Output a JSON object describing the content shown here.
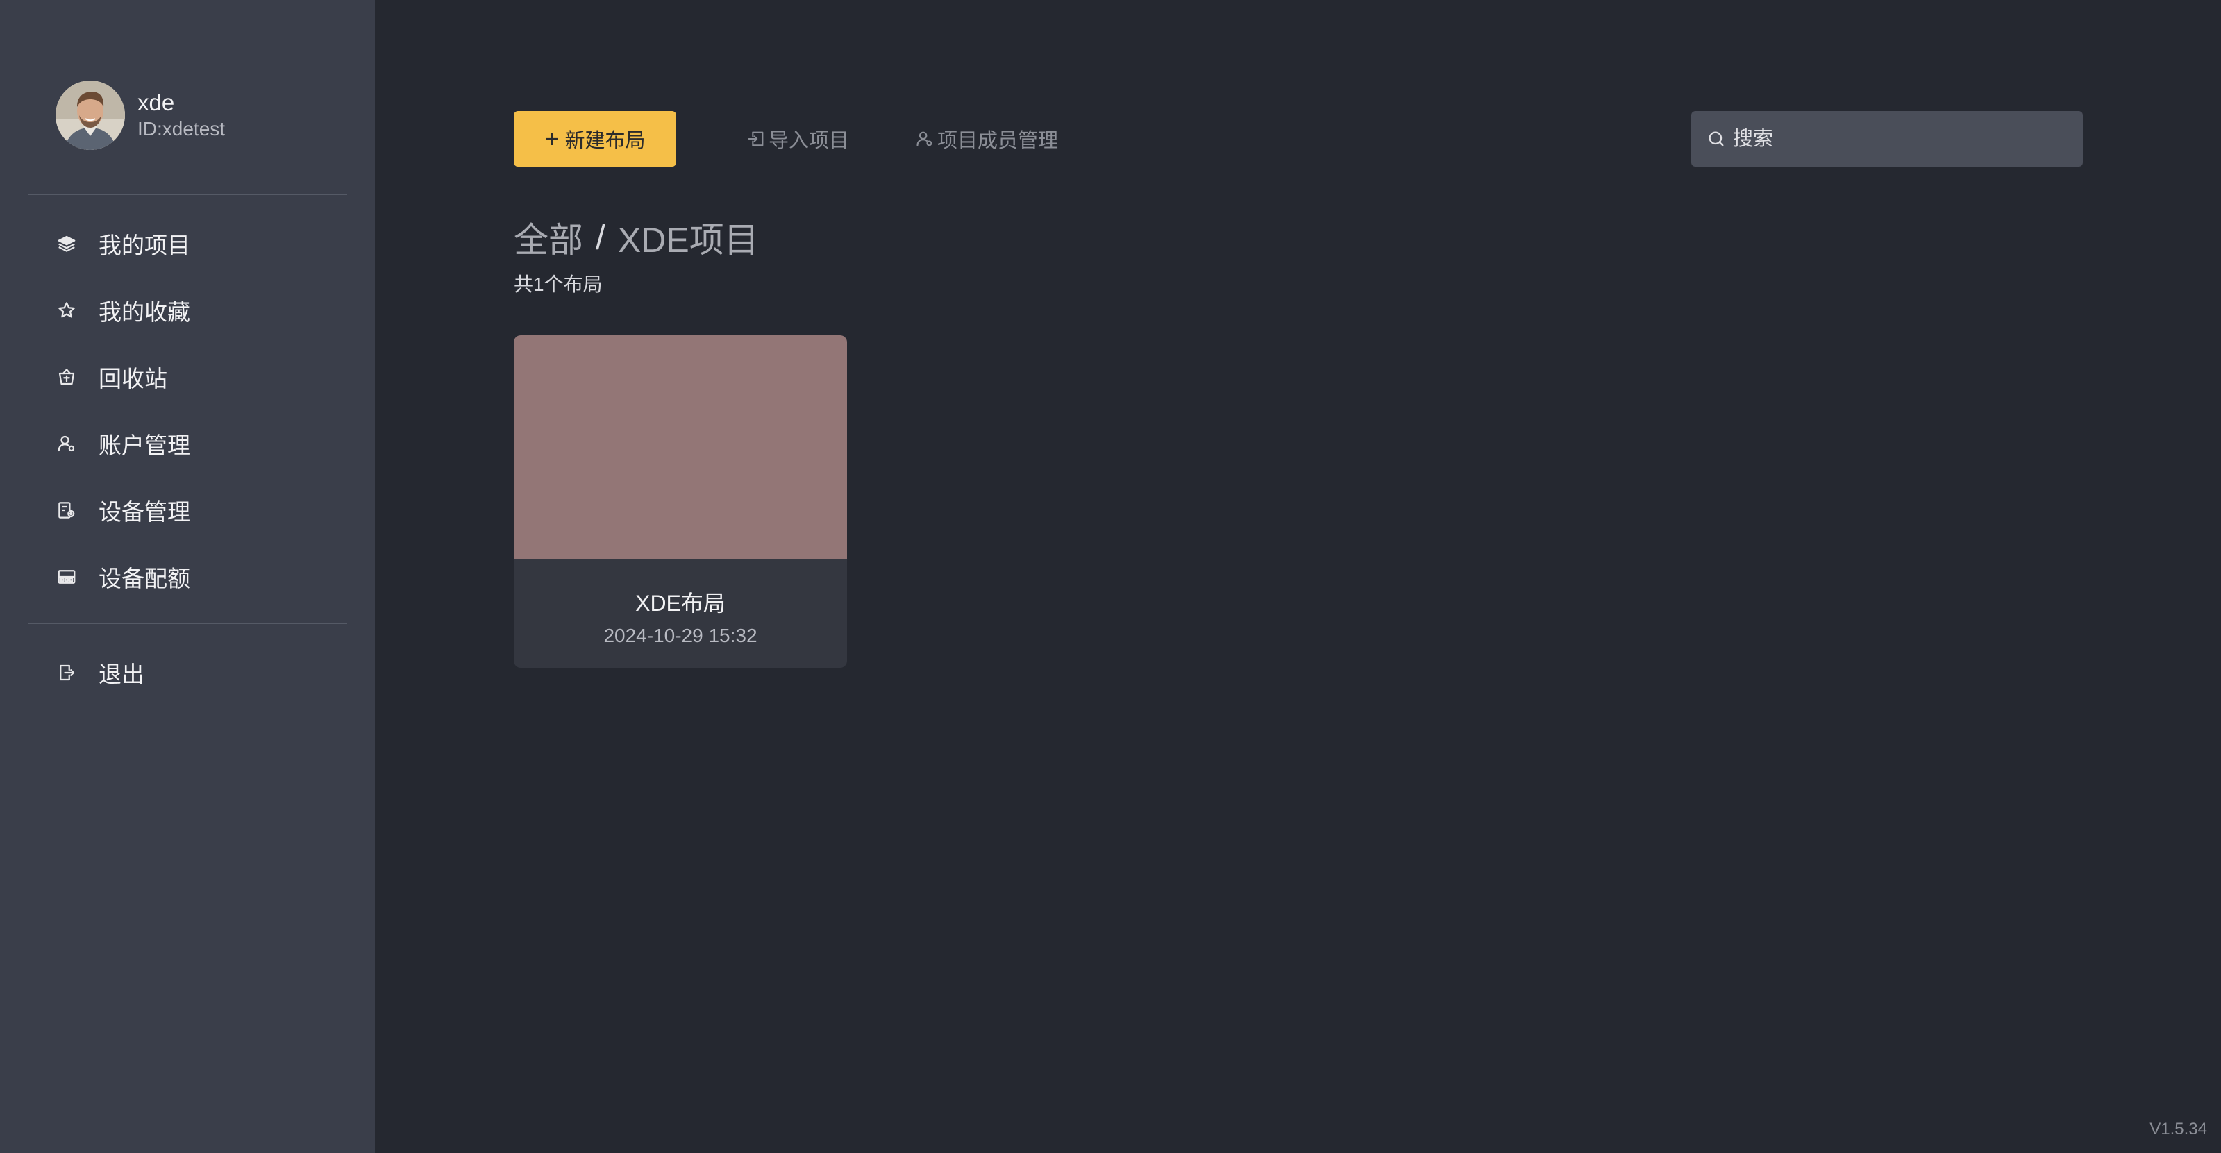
{
  "user": {
    "name": "xde",
    "id": "ID:xdetest"
  },
  "sidebar": {
    "items": [
      {
        "label": "我的项目",
        "icon": "layers-icon"
      },
      {
        "label": "我的收藏",
        "icon": "star-icon"
      },
      {
        "label": "回收站",
        "icon": "trash-icon"
      },
      {
        "label": "账户管理",
        "icon": "user-icon"
      },
      {
        "label": "设备管理",
        "icon": "device-settings-icon"
      },
      {
        "label": "设备配额",
        "icon": "quota-icon"
      }
    ],
    "logout": {
      "label": "退出",
      "icon": "logout-icon"
    }
  },
  "toolbar": {
    "new_label": "新建布局",
    "import_label": "导入项目",
    "members_label": "项目成员管理",
    "search_placeholder": "搜索"
  },
  "breadcrumb": {
    "root": "全部",
    "separator": "/",
    "current": "XDE项目"
  },
  "summary": {
    "count_text": "共1个布局"
  },
  "layouts": [
    {
      "name": "XDE布局",
      "date": "2024-10-29 15:32",
      "thumb_color": "#937676"
    }
  ],
  "colors": {
    "accent": "#f5bf48",
    "sidebar_bg": "#3a3e4a",
    "main_bg": "#252830"
  },
  "version": "V1.5.34"
}
